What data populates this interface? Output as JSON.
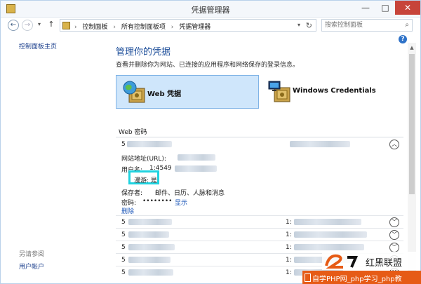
{
  "window": {
    "title": "凭据管理器",
    "min_glyph": "—",
    "max_glyph": "□",
    "close_glyph": "✕"
  },
  "nav": {
    "back_glyph": "←",
    "forward_glyph": "→",
    "recent_glyph": "▾",
    "up_glyph": "↑",
    "breadcrumbs": [
      "控制面板",
      "所有控制面板项",
      "凭据管理器"
    ],
    "breadcrumb_sep": "›",
    "dropdown_glyph": "▾",
    "refresh_glyph": "↻",
    "search_placeholder": "搜索控制面板",
    "search_glyph": "⌕"
  },
  "help": {
    "glyph": "?"
  },
  "sidebar": {
    "home_link": "控制面板主页",
    "see_also": "另请参阅",
    "user_accounts": "用户帐户"
  },
  "main": {
    "heading": "管理你的凭据",
    "description": "查看并删除你为网站、已连接的应用程序和网络保存的登录信息。",
    "vaults": [
      {
        "label": "Web 凭据",
        "icon": "globe-vault-icon",
        "selected": true
      },
      {
        "label": "Windows Credentials",
        "icon": "computer-vault-icon",
        "selected": false
      }
    ],
    "section_title": "Web 密码",
    "expanded_entry": {
      "prefix": "5",
      "url_label": "网站地址(URL):",
      "user_label": "用户名:",
      "user_value": "1:4549",
      "roaming_label": "漫游: 是",
      "saved_by_label": "保存者:",
      "saved_by_value": "邮件、日历、人脉和消息",
      "password_label": "密码:",
      "password_value": "••••••••",
      "show_link": "显示",
      "delete_link": "删除",
      "chevron": "︿"
    },
    "collapsed_entries": [
      {
        "prefix": "5",
        "user_prefix": "1:",
        "chevron": "﹀"
      },
      {
        "prefix": "5",
        "user_prefix": "1:",
        "chevron": "﹀"
      },
      {
        "prefix": "5",
        "user_prefix": "1:",
        "chevron": "﹀"
      },
      {
        "prefix": "5",
        "user_prefix": "1:",
        "chevron": "﹀"
      },
      {
        "prefix": "5",
        "user_prefix": "1:",
        "chevron": "﹀"
      }
    ]
  },
  "scrollbar": {
    "up_glyph": "▲"
  },
  "watermark": {
    "logo_text": "红黑联盟",
    "bar_text": "自学PHP网_php学习_php教"
  },
  "colors": {
    "accent": "#1d4e9a",
    "link": "#1a55b8",
    "selected_vault": "#cfe6fb",
    "highlight_box": "#1fd3e0",
    "close_button": "#c7443a",
    "watermark": "#e65b16"
  }
}
